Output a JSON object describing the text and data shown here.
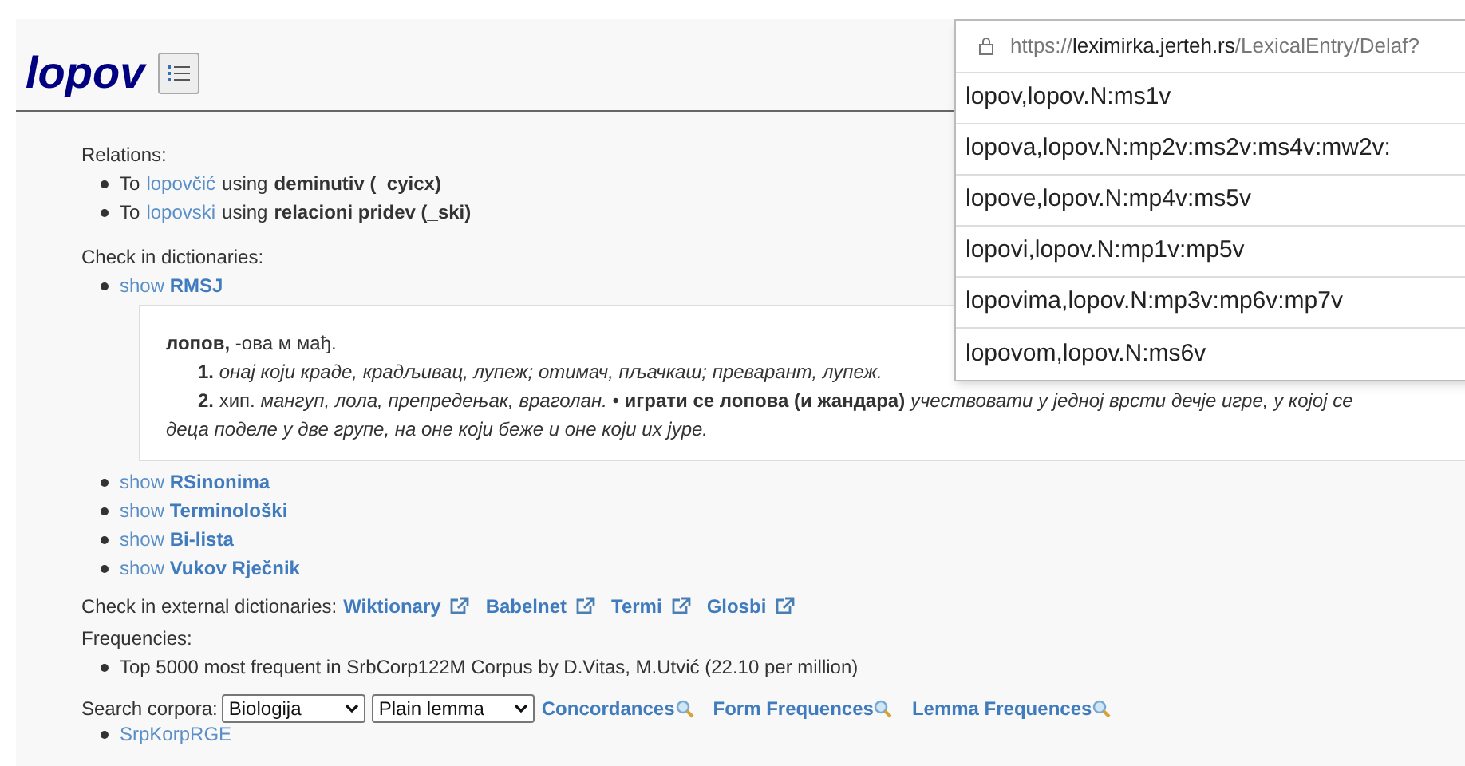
{
  "title": "lopov",
  "relations": {
    "label": "Relations:",
    "items": [
      {
        "prefix": "To",
        "link": "lopovčić",
        "using": "using",
        "type": "deminutiv (_cyicx)"
      },
      {
        "prefix": "To",
        "link": "lopovski",
        "using": "using",
        "type": "relacioni pridev (_ski)"
      }
    ]
  },
  "dictionaries": {
    "label": "Check in dictionaries:",
    "items": [
      {
        "show": "show",
        "name": "RMSJ",
        "entry": {
          "head": "**лопов,** -ова м мађ.",
          "senses": [
            "**1.** *онај који краде, крадљивац, лупеж; отимач, пљачкаш; преварант, лупеж.*",
            "**2.** хип. *мангуп, лола, препредењак, враголан.* • **играти се лопова (и жандара)** *учествовати у једној врсти дечје игре, у којој се деца поделе у две групе, на оне који беже и оне који их јуре.*"
          ]
        }
      },
      {
        "show": "show",
        "name": "RSinonima"
      },
      {
        "show": "show",
        "name": "Terminološki"
      },
      {
        "show": "show",
        "name": "Bi-lista"
      },
      {
        "show": "show",
        "name": "Vukov Rječnik"
      }
    ]
  },
  "external": {
    "label": "Check in external dictionaries:",
    "links": [
      "Wiktionary",
      "Babelnet",
      "Termi",
      "Glosbi"
    ]
  },
  "frequencies": {
    "label": "Frequencies:",
    "items": [
      "Top 5000 most frequent in SrbCorp122M Corpus by D.Vitas, M.Utvić (22.10 per million)"
    ]
  },
  "search": {
    "label": "Search corpora:",
    "corpus": "Biologija",
    "mode": "Plain lemma",
    "links": [
      "Concordances",
      "Form Frequences",
      "Lemma Frequences"
    ],
    "items": [
      "SrpKorpRGE"
    ]
  },
  "popup": {
    "url_prefix": "https://",
    "url_host": "leximirka.jerteh.rs",
    "url_path": "/LexicalEntry/Delaf?",
    "lines": [
      "lopov,lopov.N:ms1v",
      "lopova,lopov.N:mp2v:ms2v:ms4v:mw2v:",
      "lopove,lopov.N:mp4v:ms5v",
      "lopovi,lopov.N:mp1v:mp5v",
      "lopovima,lopov.N:mp3v:mp6v:mp7v",
      "lopovom,lopov.N:ms6v"
    ]
  }
}
